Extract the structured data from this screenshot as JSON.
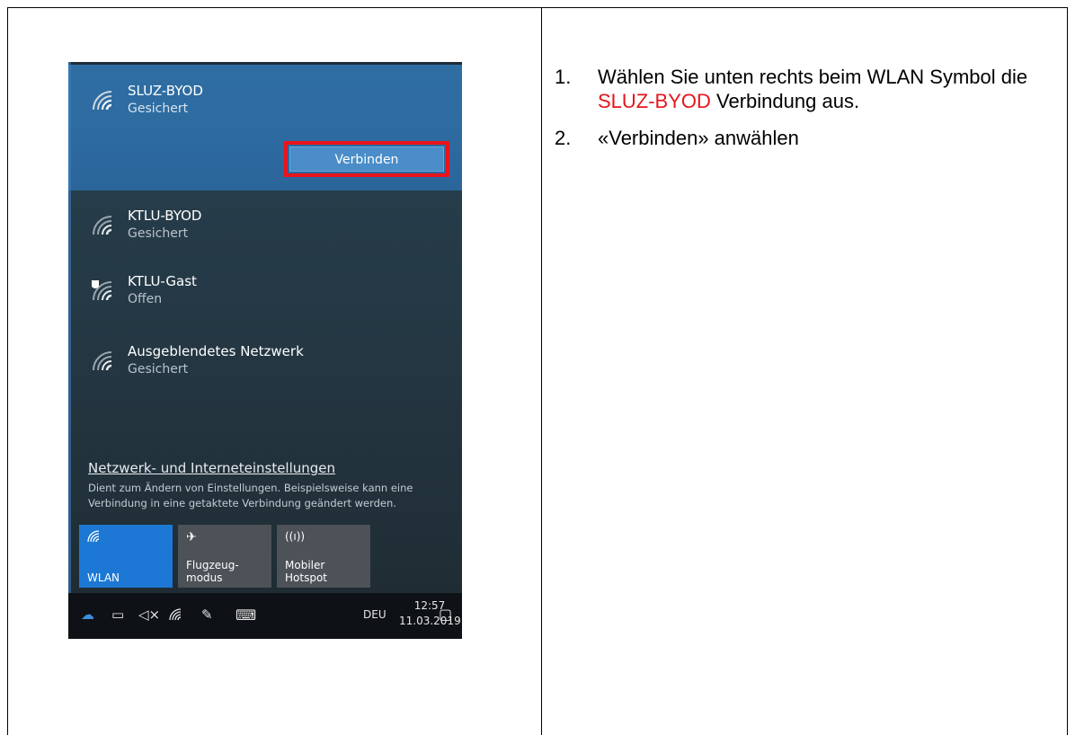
{
  "wifi_panel": {
    "networks": [
      {
        "name": "SLUZ-BYOD",
        "status": "Gesichert"
      },
      {
        "name": "KTLU-BYOD",
        "status": "Gesichert"
      },
      {
        "name": "KTLU-Gast",
        "status": "Offen"
      },
      {
        "name": "Ausgeblendetes Netzwerk",
        "status": "Gesichert"
      }
    ],
    "connect_button": "Verbinden",
    "settings_link": "Netzwerk- und Interneteinstellungen",
    "settings_description": "Dient zum Ändern von Einstellungen. Beispielsweise kann eine Verbindung in eine getaktete Verbindung geändert werden.",
    "tiles": [
      {
        "label": "WLAN",
        "icon": "wifi-icon"
      },
      {
        "label_line1": "Flugzeug-",
        "label_line2": "modus",
        "icon": "airplane-icon"
      },
      {
        "label_line1": "Mobiler",
        "label_line2": "Hotspot",
        "icon": "hotspot-icon"
      }
    ],
    "taskbar": {
      "language": "DEU",
      "time": "12:57",
      "date": "11.03.2019"
    }
  },
  "instructions": {
    "step1_number": "1.",
    "step1_before": "Wählen Sie unten rechts beim WLAN Symbol die ",
    "step1_highlight": "SLUZ-BYOD",
    "step1_after": " Verbindung aus.",
    "step2_number": "2.",
    "step2_text": "«Verbinden» anwählen"
  },
  "colors": {
    "highlight_red": "#e8141c",
    "selected_blue": "#2f6ea3",
    "active_tile": "#1c78d4"
  }
}
